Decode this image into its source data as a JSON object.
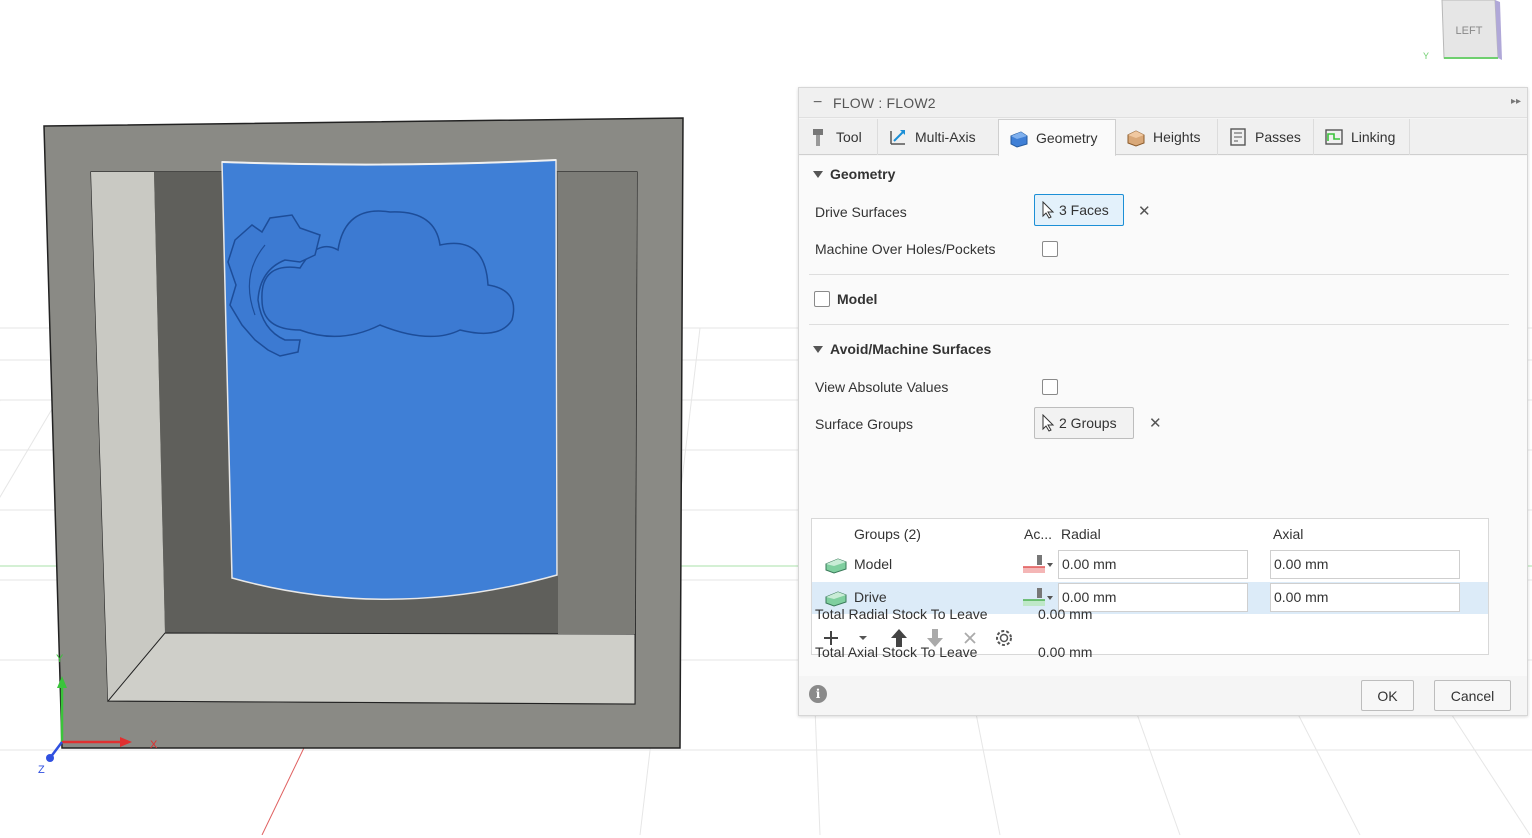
{
  "viewcube": {
    "face_label": "LEFT",
    "axis_label": "Y"
  },
  "triad": {
    "x_label": "X",
    "y_label": "Y",
    "z_label": "Z"
  },
  "dialog": {
    "title": "FLOW : FLOW2",
    "tabs": [
      {
        "label": "Tool",
        "icon": "tool-icon"
      },
      {
        "label": "Multi-Axis",
        "icon": "multi-axis-icon"
      },
      {
        "label": "Geometry",
        "icon": "geometry-icon",
        "active": true
      },
      {
        "label": "Heights",
        "icon": "heights-icon"
      },
      {
        "label": "Passes",
        "icon": "passes-icon"
      },
      {
        "label": "Linking",
        "icon": "linking-icon"
      }
    ],
    "geometry": {
      "header": "Geometry",
      "drive_surfaces_label": "Drive Surfaces",
      "drive_surfaces_value": "3 Faces",
      "machine_over_holes_label": "Machine Over Holes/Pockets",
      "machine_over_holes_checked": false
    },
    "model": {
      "label": "Model",
      "checked": false
    },
    "avoid": {
      "header": "Avoid/Machine Surfaces",
      "view_absolute_label": "View Absolute Values",
      "view_absolute_checked": false,
      "surface_groups_label": "Surface Groups",
      "surface_groups_value": "2 Groups",
      "table": {
        "col_groups": "Groups (2)",
        "col_action": "Ac...",
        "col_radial": "Radial",
        "col_axial": "Axial",
        "rows": [
          {
            "name": "Model",
            "action_color": "#e05555",
            "radial": "0.00 mm",
            "axial": "0.00 mm",
            "selected": false
          },
          {
            "name": "Drive",
            "action_color": "#4caf50",
            "radial": "0.00 mm",
            "axial": "0.00 mm",
            "selected": true
          }
        ]
      },
      "total_radial_label": "Total Radial Stock To Leave",
      "total_radial_value": "0.00 mm",
      "total_axial_label": "Total Axial Stock To Leave",
      "total_axial_value": "0.00 mm"
    },
    "ok_label": "OK",
    "cancel_label": "Cancel",
    "info_glyph": "i"
  },
  "colors": {
    "accent": "#1c8fd6",
    "surface_blue": "#3f7fd6",
    "frame": "#8a8a85"
  }
}
